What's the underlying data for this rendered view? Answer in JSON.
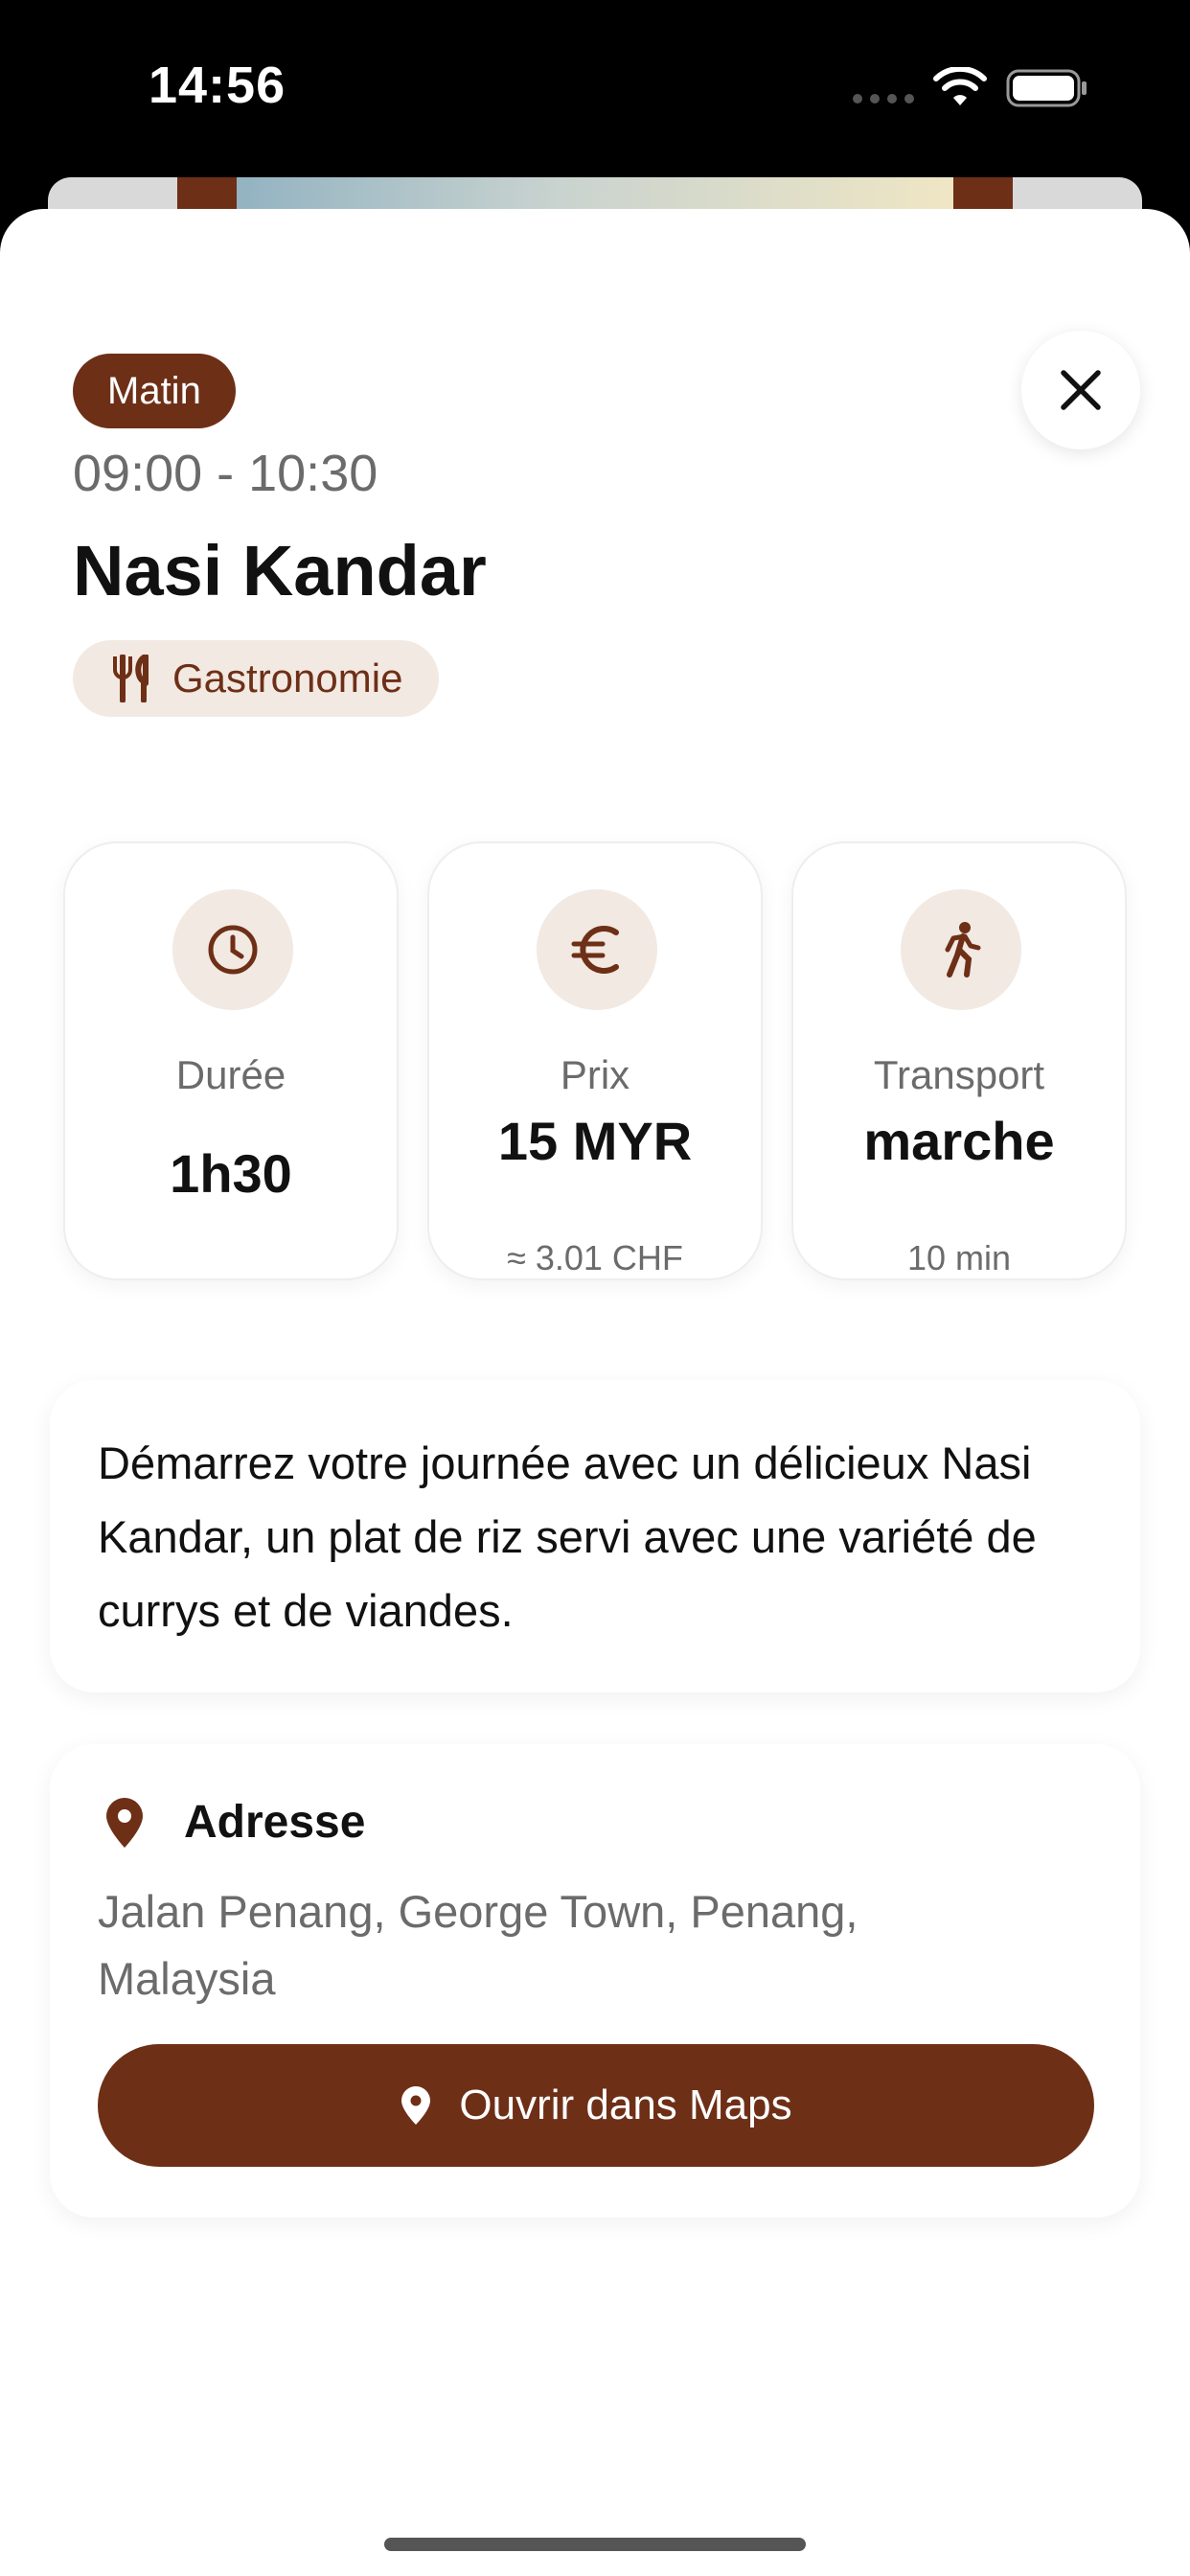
{
  "status_bar": {
    "time": "14:56",
    "icons": [
      "signal-dots-icon",
      "wifi-icon",
      "battery-icon"
    ]
  },
  "theme": {
    "accent": "#6e2f17",
    "accent_soft": "#f1e9e2",
    "text_primary": "#111111",
    "text_secondary": "#6b6b6b"
  },
  "activity": {
    "period": "Matin",
    "time_range": "09:00 - 10:30",
    "title": "Nasi Kandar",
    "category": {
      "label": "Gastronomie",
      "icon": "fork-knife-icon"
    }
  },
  "info_cards": {
    "duration": {
      "icon": "clock-icon",
      "label": "Durée",
      "value": "1h30"
    },
    "price": {
      "icon": "euro-icon",
      "label": "Prix",
      "value": "15 MYR",
      "sub": "≈ 3.01 CHF"
    },
    "transport": {
      "icon": "walking-icon",
      "label": "Transport",
      "value": "marche",
      "sub": "10 min"
    }
  },
  "description": "Démarrez votre journée avec un délicieux Nasi Kandar, un plat de riz servi avec une variété de currys et de viandes.",
  "address": {
    "heading": "Adresse",
    "line1": "Jalan Penang, George Town, Penang,",
    "line2": "Malaysia",
    "button_label": "Ouvrir dans Maps"
  }
}
